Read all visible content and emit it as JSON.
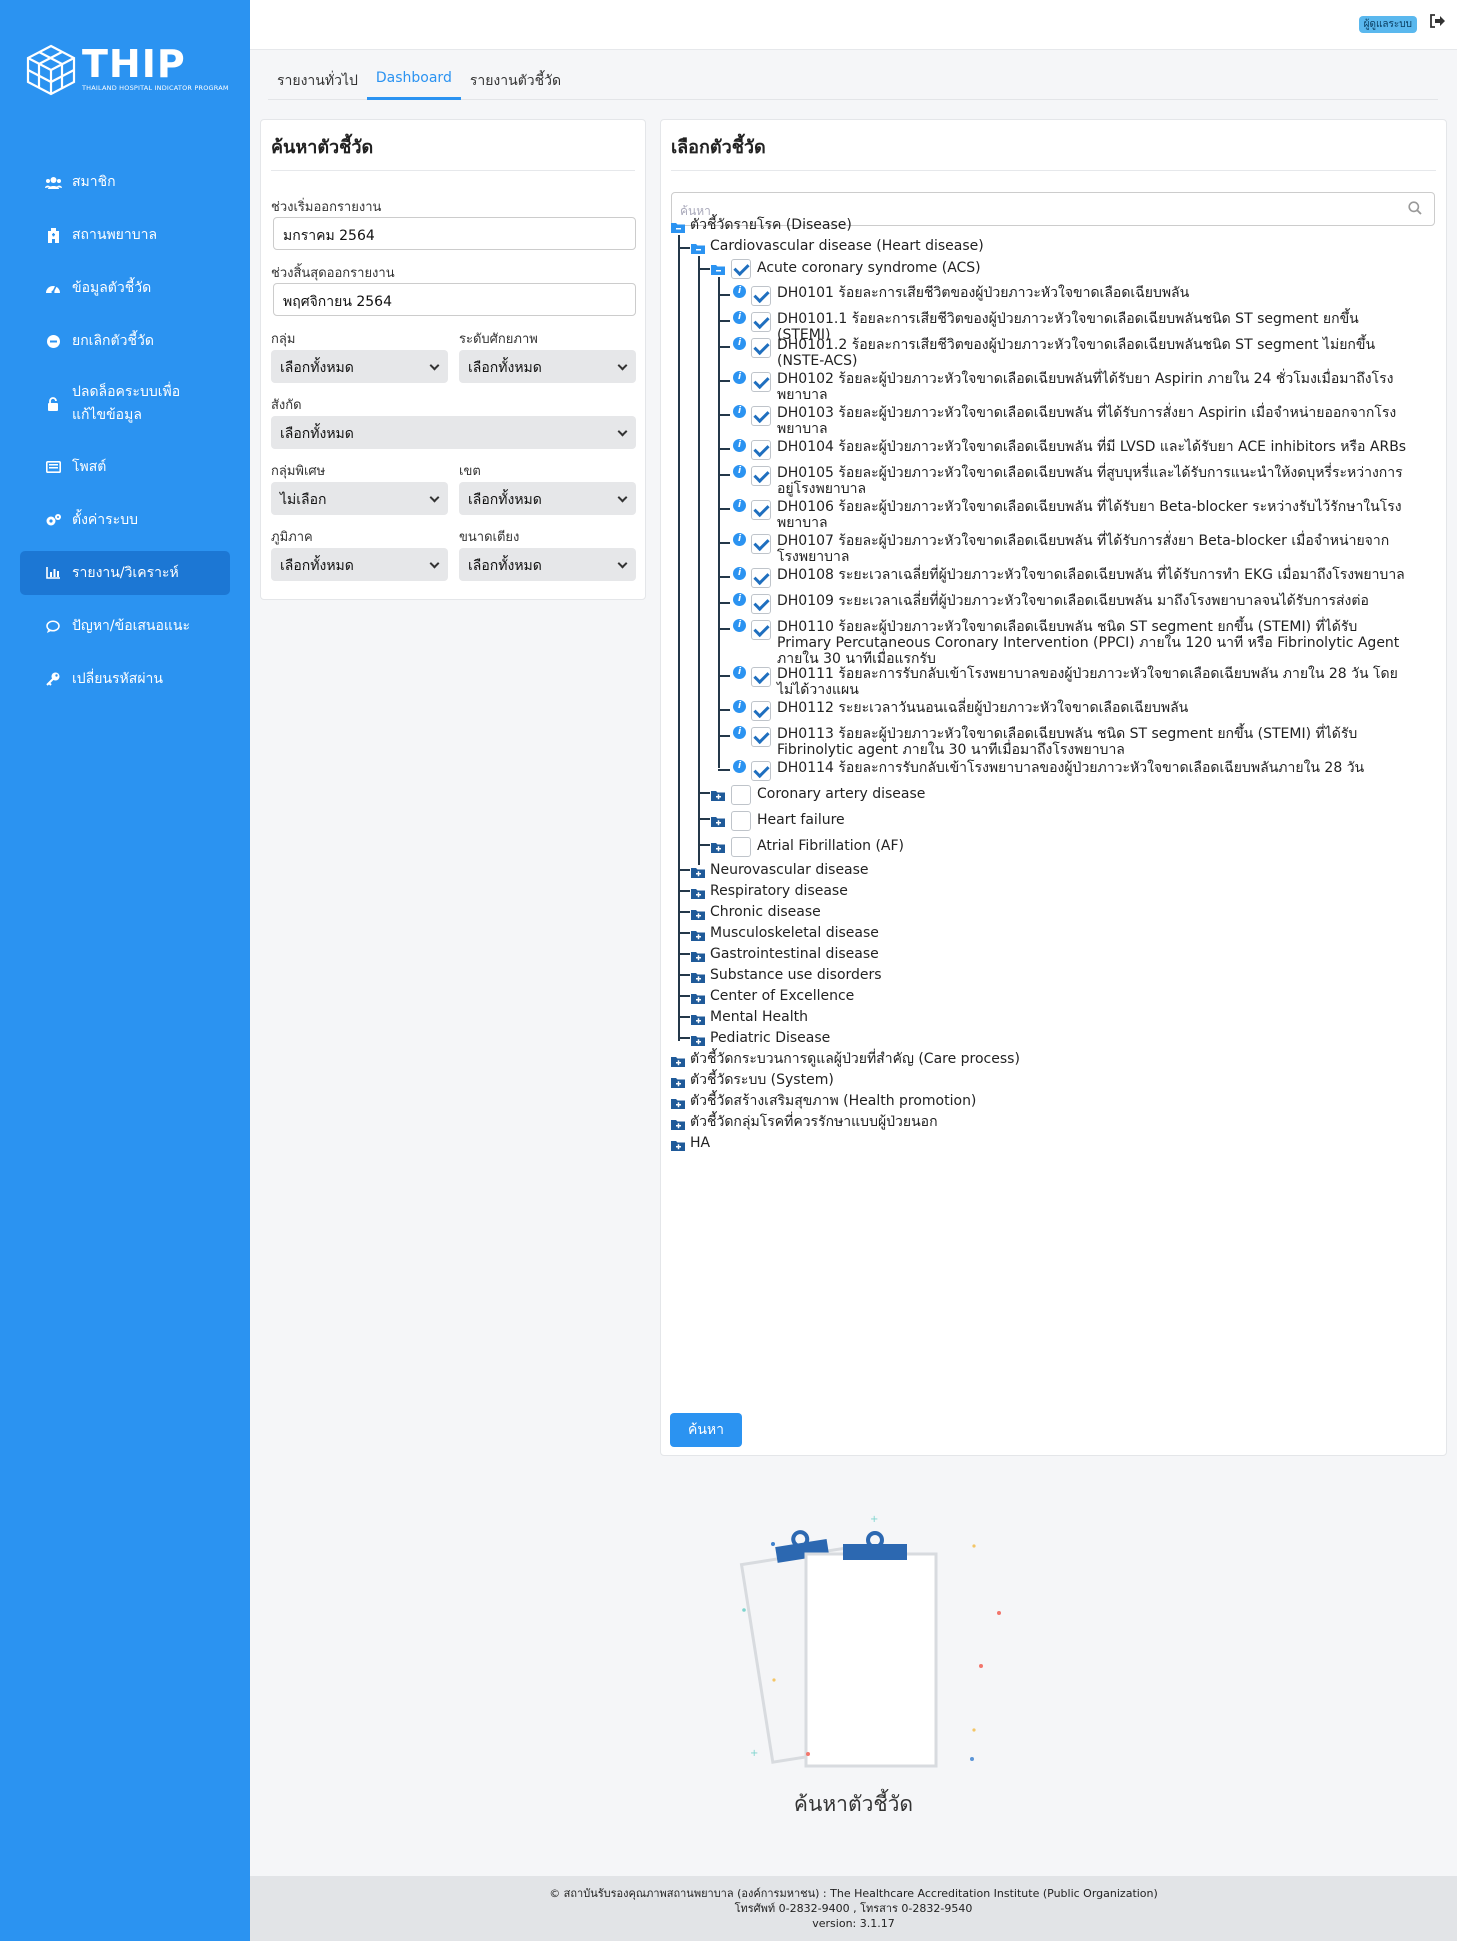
{
  "brand": {
    "name": "THIP",
    "subtitle": "THAILAND HOSPITAL INDICATOR PROGRAM",
    "color": "#2b93f1"
  },
  "sidebar": {
    "items": [
      {
        "label": "สมาชิก",
        "icon": "users-icon"
      },
      {
        "label": "สถานพยาบาล",
        "icon": "hospital-icon"
      },
      {
        "label": "ข้อมูลตัวชี้วัด",
        "icon": "gauge-icon"
      },
      {
        "label": "ยกเลิกตัวชี้วัด",
        "icon": "minus-circle-icon"
      },
      {
        "label": "ปลดล็อคระบบเพื่อแก้ไขข้อมูล",
        "icon": "lock-icon"
      },
      {
        "label": "โพสต์",
        "icon": "post-icon"
      },
      {
        "label": "ตั้งค่าระบบ",
        "icon": "cogs-icon"
      },
      {
        "label": "รายงาน/วิเคราะห์",
        "icon": "chart-icon",
        "active": true
      },
      {
        "label": "ปัญหา/ข้อเสนอแนะ",
        "icon": "comment-icon"
      },
      {
        "label": "เปลี่ยนรหัสผ่าน",
        "icon": "key-icon"
      }
    ]
  },
  "header": {
    "user": "ผู้ดูแลระบบ"
  },
  "tabs": [
    "รายงานทั่วไป",
    "Dashboard",
    "รายงานตัวชี้วัด"
  ],
  "filter": {
    "title": "ค้นหาตัวชี้วัด",
    "start_label": "ช่วงเริ่มออกรายงาน",
    "start_value": "มกราคม 2564",
    "end_label": "ช่วงสิ้นสุดออกรายงาน",
    "end_value": "พฤศจิกายน 2564",
    "group_label": "กลุ่ม",
    "group_value": "เลือกทั้งหมด",
    "level_label": "ระดับศักยภาพ",
    "level_value": "เลือกทั้งหมด",
    "affil_label": "สังกัด",
    "affil_value": "เลือกทั้งหมด",
    "special_label": "กลุ่มพิเศษ",
    "special_value": "ไม่เลือก",
    "zone_label": "เขต",
    "zone_value": "เลือกทั้งหมด",
    "region_label": "ภูมิภาค",
    "region_value": "เลือกทั้งหมด",
    "beds_label": "ขนาดเตียง",
    "beds_value": "เลือกทั้งหมด"
  },
  "selector": {
    "title": "เลือกตัวชี้วัด",
    "search_placeholder": "ค้นหา",
    "root": "ตัวชี้วัดรายโรค (Disease)",
    "cardio": "Cardiovascular disease (Heart disease)",
    "acs": "Acute coronary syndrome (ACS)",
    "indicators": [
      "DH0101 ร้อยละการเสียชีวิตของผู้ป่วยภาวะหัวใจขาดเลือดเฉียบพลัน",
      "DH0101.1 ร้อยละการเสียชีวิตของผู้ป่วยภาวะหัวใจขาดเลือดเฉียบพลันชนิด ST segment ยกขึ้น (STEMI)",
      "DH0101.2 ร้อยละการเสียชีวิตของผู้ป่วยภาวะหัวใจขาดเลือดเฉียบพลันชนิด ST segment ไม่ยกขึ้น (NSTE-ACS)",
      "DH0102 ร้อยละผู้ป่วยภาวะหัวใจขาดเลือดเฉียบพลันที่ได้รับยา Aspirin ภายใน 24 ชั่วโมงเมื่อมาถึงโรงพยาบาล",
      "DH0103 ร้อยละผู้ป่วยภาวะหัวใจขาดเลือดเฉียบพลัน ที่ได้รับการสั่งยา Aspirin เมื่อจำหน่ายออกจากโรงพยาบาล",
      "DH0104 ร้อยละผู้ป่วยภาวะหัวใจขาดเลือดเฉียบพลัน ที่มี LVSD และได้รับยา ACE inhibitors หรือ ARBs",
      "DH0105 ร้อยละผู้ป่วยภาวะหัวใจขาดเลือดเฉียบพลัน ที่สูบบุหรี่และได้รับการแนะนำให้งดบุหรี่ระหว่างการอยู่โรงพยาบาล",
      "DH0106 ร้อยละผู้ป่วยภาวะหัวใจขาดเลือดเฉียบพลัน ที่ได้รับยา Beta-blocker ระหว่างรับไว้รักษาในโรงพยาบาล",
      "DH0107 ร้อยละผู้ป่วยภาวะหัวใจขาดเลือดเฉียบพลัน ที่ได้รับการสั่งยา Beta-blocker เมื่อจำหน่ายจากโรงพยาบาล",
      "DH0108 ระยะเวลาเฉลี่ยที่ผู้ป่วยภาวะหัวใจขาดเลือดเฉียบพลัน ที่ได้รับการทำ EKG เมื่อมาถึงโรงพยาบาล",
      "DH0109 ระยะเวลาเฉลี่ยที่ผู้ป่วยภาวะหัวใจขาดเลือดเฉียบพลัน มาถึงโรงพยาบาลจนได้รับการส่งต่อ",
      "DH0110 ร้อยละผู้ป่วยภาวะหัวใจขาดเลือดเฉียบพลัน ชนิด ST segment ยกขึ้น (STEMI) ที่ได้รับ Primary Percutaneous Coronary Intervention (PPCI) ภายใน 120 นาที หรือ Fibrinolytic Agent ภายใน 30 นาทีเมื่อแรกรับ",
      "DH0111 ร้อยละการรับกลับเข้าโรงพยาบาลของผู้ป่วยภาวะหัวใจขาดเลือดเฉียบพลัน ภายใน 28 วัน โดยไม่ได้วางแผน",
      "DH0112 ระยะเวลาวันนอนเฉลี่ยผู้ป่วยภาวะหัวใจขาดเลือดเฉียบพลัน",
      "DH0113 ร้อยละผู้ป่วยภาวะหัวใจขาดเลือดเฉียบพลัน ชนิด ST segment ยกขึ้น (STEMI) ที่ได้รับ Fibrinolytic agent ภายใน 30 นาทีเมื่อมาถึงโรงพยาบาล",
      "DH0114 ร้อยละการรับกลับเข้าโรงพยาบาลของผู้ป่วยภาวะหัวใจขาดเลือดเฉียบพลันภายใน 28 วัน"
    ],
    "cardio_children": [
      "Coronary artery disease",
      "Heart failure",
      "Atrial Fibrillation (AF)"
    ],
    "disease_groups": [
      "Neurovascular disease",
      "Respiratory disease",
      "Chronic disease",
      "Musculoskeletal disease",
      "Gastrointestinal disease",
      "Substance use disorders",
      "Center of Excellence",
      "Mental Health",
      "Pediatric Disease"
    ],
    "roots": [
      "ตัวชี้วัดกระบวนการดูแลผู้ป่วยที่สำคัญ (Care process)",
      "ตัวชี้วัดระบบ (System)",
      "ตัวชี้วัดสร้างเสริมสุขภาพ (Health promotion)",
      "ตัวชี้วัดกลุ่มโรคที่ควรรักษาแบบผู้ป่วยนอก",
      "HA"
    ],
    "search_button": "ค้นหา"
  },
  "empty_state": {
    "title": "ค้นหาตัวชี้วัด"
  },
  "footer": {
    "line1": "© สถาบันรับรองคุณภาพสถานพยาบาล (องค์การมหาชน) : The Healthcare Accreditation Institute (Public Organization)",
    "line2": "โทรศัพท์ 0-2832-9400 , โทรสาร 0-2832-9540",
    "line3": "version: 3.1.17"
  }
}
